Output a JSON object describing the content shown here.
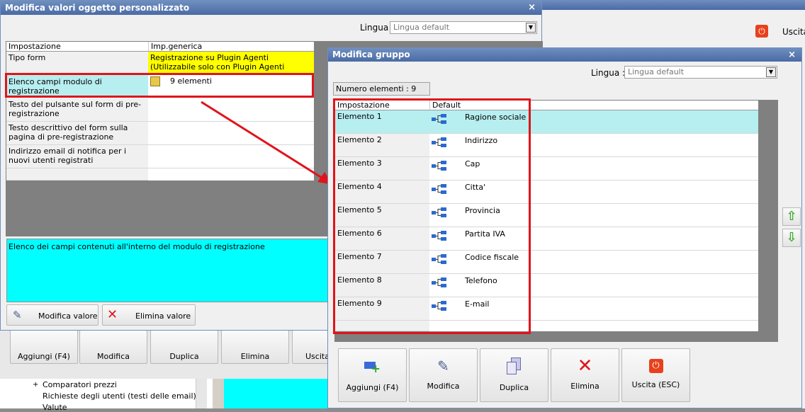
{
  "win1": {
    "title": "Modifica valori oggetto personalizzato",
    "lang_label": "Lingua :",
    "lang_value": "Lingua default",
    "col1": "Impostazione",
    "col2": "Imp.generica",
    "rows": [
      {
        "label": "Tipo form",
        "value": "Registrazione su Plugin Agenti (Utilizzabile solo con Plugin Agenti installato)"
      },
      {
        "label": "Elenco campi modulo di registrazione",
        "value": "9 elementi"
      },
      {
        "label": "Testo del pulsante sul form di pre-registrazione",
        "value": ""
      },
      {
        "label": "Testo descrittivo del form sulla pagina di pre-registrazione",
        "value": ""
      },
      {
        "label": "Indirizzo email di notifica per i nuovi utenti registrati",
        "value": ""
      }
    ],
    "description": "Elenco dei campi contenuti all'interno del modulo di registrazione",
    "btn_edit": "Modifica valore",
    "btn_delete": "Elimina valore"
  },
  "bg": {
    "uscita": "Uscita",
    "toolbar": [
      "Aggiungi (F4)",
      "Modifica",
      "Duplica",
      "Elimina",
      "Uscita"
    ],
    "tree": [
      "Comparatori prezzi",
      "Richieste degli utenti (testi delle email)",
      "Valute"
    ]
  },
  "win2": {
    "title": "Modifica gruppo",
    "lang_label": "Lingua :",
    "lang_value": "Lingua default",
    "count_label": "Numero elementi : 9",
    "col1": "Impostazione",
    "col2": "Default",
    "rows": [
      {
        "label": "Elemento 1",
        "value": "Ragione sociale"
      },
      {
        "label": "Elemento 2",
        "value": "Indirizzo"
      },
      {
        "label": "Elemento 3",
        "value": "Cap"
      },
      {
        "label": "Elemento 4",
        "value": "Citta'"
      },
      {
        "label": "Elemento 5",
        "value": "Provincia"
      },
      {
        "label": "Elemento 6",
        "value": "Partita IVA"
      },
      {
        "label": "Elemento 7",
        "value": "Codice fiscale"
      },
      {
        "label": "Elemento 8",
        "value": "Telefono"
      },
      {
        "label": "Elemento 9",
        "value": "E-mail"
      }
    ],
    "toolbar": [
      "Aggiungi (F4)",
      "Modifica",
      "Duplica",
      "Elimina",
      "Uscita (ESC)"
    ]
  },
  "colors": {
    "accent_red": "#e0141b",
    "selected_row": "#b7eef0",
    "description_bg": "#00ffff",
    "yellow": "#ffff00"
  }
}
